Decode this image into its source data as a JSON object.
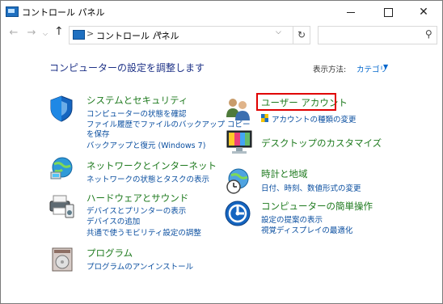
{
  "window": {
    "title": "コントロール パネル",
    "minimize_glyph": "—",
    "maximize_glyph": "☐",
    "close_glyph": "✕"
  },
  "nav": {
    "back": "←",
    "forward": "→",
    "up": "↑",
    "breadcrumb": "コントロール パネル",
    "separator": ">",
    "refresh": "↻",
    "search_placeholder": ""
  },
  "main": {
    "heading": "コンピューターの設定を調整します",
    "view_by_label": "表示方法:",
    "view_by_value": "カテゴリ",
    "categories": [
      {
        "title": "システムとセキュリティ",
        "icon": "system-security-shield-icon",
        "links": [
          "コンピューターの状態を確認",
          "ファイル履歴でファイルのバックアップ コピー",
          "を保存",
          "バックアップと復元 (Windows 7)"
        ]
      },
      {
        "title": "ネットワークとインターネット",
        "icon": "network-globe-icon",
        "links": [
          "ネットワークの状態とタスクの表示"
        ]
      },
      {
        "title": "ハードウェアとサウンド",
        "icon": "printer-speaker-icon",
        "links": [
          "デバイスとプリンターの表示",
          "デバイスの追加",
          "共通で使うモビリティ設定の調整"
        ]
      },
      {
        "title": "プログラム",
        "icon": "programs-disc-icon",
        "links": [
          "プログラムのアンインストール"
        ]
      },
      {
        "title": "ユーザー アカウント",
        "icon": "user-accounts-icon",
        "links": [
          "アカウントの種類の変更"
        ]
      },
      {
        "title": "デスクトップのカスタマイズ",
        "icon": "desktop-monitor-icon",
        "links": []
      },
      {
        "title": "時計と地域",
        "icon": "clock-globe-icon",
        "links": [
          "日付、時刻、数値形式の変更"
        ]
      },
      {
        "title": "コンピューターの簡単操作",
        "icon": "ease-of-access-icon",
        "links": [
          "設定の提案の表示",
          "視覚ディスプレイの最適化"
        ]
      }
    ]
  },
  "colors": {
    "category_title": "#1e7a1e",
    "link": "#0b4fa0",
    "heading": "#1e3287",
    "highlight": "#e00000"
  }
}
